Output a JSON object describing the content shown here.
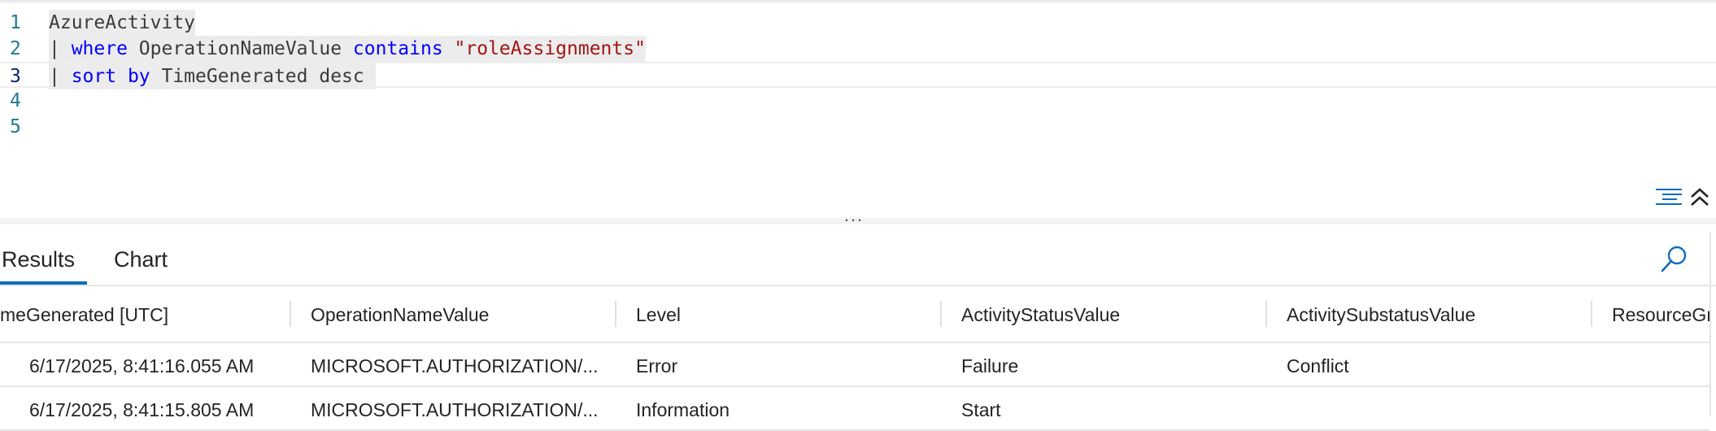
{
  "editor": {
    "lines": [
      {
        "number": "1",
        "tokens": [
          {
            "t": "AzureActivity",
            "c": "ident"
          }
        ]
      },
      {
        "number": "2",
        "tokens": [
          {
            "t": "| ",
            "c": "ident"
          },
          {
            "t": "where",
            "c": "kw"
          },
          {
            "t": " OperationNameValue ",
            "c": "ident"
          },
          {
            "t": "contains",
            "c": "kw"
          },
          {
            "t": " ",
            "c": "ident"
          },
          {
            "t": "\"roleAssignments\"",
            "c": "str"
          }
        ]
      },
      {
        "number": "3",
        "tokens": [
          {
            "t": "| ",
            "c": "ident"
          },
          {
            "t": "sort by",
            "c": "kw"
          },
          {
            "t": " TimeGenerated desc ",
            "c": "ident"
          }
        ]
      },
      {
        "number": "4",
        "tokens": []
      },
      {
        "number": "5",
        "tokens": []
      }
    ],
    "current_line": 3,
    "splitter_label": "..."
  },
  "results": {
    "tabs": [
      {
        "label": "Results",
        "active": true
      },
      {
        "label": "Chart",
        "active": false
      }
    ],
    "columns": [
      "meGenerated [UTC]",
      "OperationNameValue",
      "Level",
      "ActivityStatusValue",
      "ActivitySubstatusValue",
      "ResourceGr"
    ],
    "rows": [
      [
        "6/17/2025, 8:41:16.055 AM",
        "MICROSOFT.AUTHORIZATION/...",
        "Error",
        "Failure",
        "Conflict",
        ""
      ],
      [
        "6/17/2025, 8:41:15.805 AM",
        "MICROSOFT.AUTHORIZATION/...",
        "Information",
        "Start",
        "",
        ""
      ]
    ]
  },
  "icons": {
    "format": "format-document-icon",
    "collapse": "chevron-double-up-icon",
    "search": "search-icon"
  },
  "colors": {
    "keyword": "#0000ff",
    "string": "#a31515",
    "accent": "#0f6cbd",
    "line_number": "#237893"
  }
}
